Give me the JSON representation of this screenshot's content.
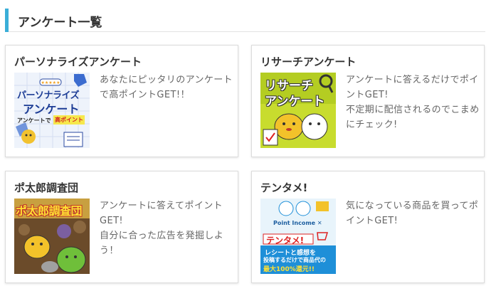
{
  "section": {
    "title": "アンケート一覧"
  },
  "cards": [
    {
      "title": "パーソナライズアンケート",
      "description": "あなたにピッタリのアンケートで高ポイントGET!！",
      "thumb": {
        "line1": "パーソナライズ",
        "line2": "アンケート",
        "caption_a": "アンケートで",
        "caption_b": "高ポイント"
      }
    },
    {
      "title": "リサーチアンケート",
      "description": "アンケートに答えるだけでポイントGET!\n不定期に配信されるのでこまめにチェック!",
      "thumb": {
        "line1": "リサーチ",
        "line2": "アンケート"
      }
    },
    {
      "title": "ポ太郎調査団",
      "description": "アンケートに答えてポイントGET!\n自分に合った広告を発掘しよう！",
      "thumb": {
        "line1": "ポ太郎調査団"
      }
    },
    {
      "title": "テンタメ!",
      "description": "気になっている商品を買ってポイントGET!",
      "thumb": {
        "brand": "Point Income ✕",
        "logo": "テンタメ!",
        "caption1": "レシートと感想を",
        "caption2": "投稿するだけで商品代の",
        "caption3": "最大100%還元!!"
      }
    }
  ]
}
